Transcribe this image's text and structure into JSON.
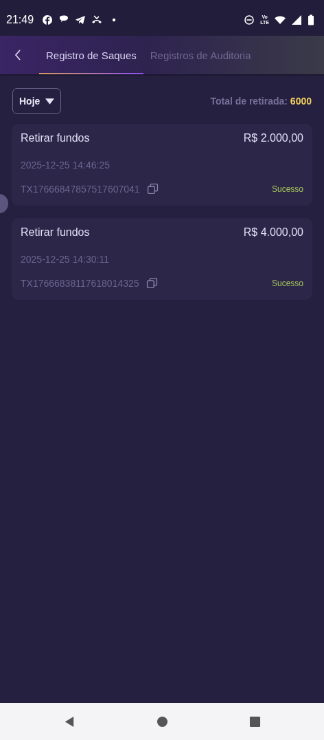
{
  "status_bar": {
    "time": "21:49",
    "network_top": "Vo",
    "network_bottom": "LTE"
  },
  "tabs": [
    {
      "label": "Registro de Saques",
      "selected": true
    },
    {
      "label": "Registros de Auditoria",
      "selected": false
    }
  ],
  "filter": {
    "value": "Hoje"
  },
  "total": {
    "label": "Total de retirada:",
    "value": "6000"
  },
  "records": [
    {
      "title": "Retirar fundos",
      "amount": "R$ 2.000,00",
      "date": "2025-12-25 14:46:25",
      "tx": "TX17666847857517607041",
      "status": "Sucesso",
      "color": "#a6c35a"
    },
    {
      "title": "Retirar fundos",
      "amount": "R$ 4.000,00",
      "date": "2025-12-25 14:30:11",
      "tx": "TX17666838117618014325",
      "status": "Sucesso",
      "color": "#a6c35a"
    }
  ]
}
